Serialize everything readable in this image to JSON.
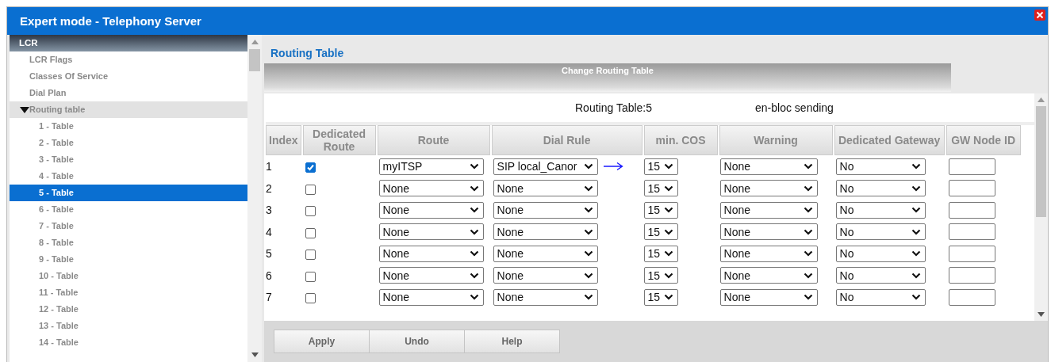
{
  "window": {
    "title": "Expert mode - Telephony Server"
  },
  "sidebar": {
    "header": "LCR",
    "items": [
      {
        "label": "LCR Flags",
        "selected": false
      },
      {
        "label": "Classes Of Service",
        "selected": false
      },
      {
        "label": "Dial Plan",
        "selected": false
      },
      {
        "label": "Routing table",
        "selected": false,
        "expanded": true,
        "children": [
          {
            "label": "1 - Table",
            "selected": false
          },
          {
            "label": "2 - Table",
            "selected": false
          },
          {
            "label": "3 - Table",
            "selected": false
          },
          {
            "label": "4 - Table",
            "selected": false
          },
          {
            "label": "5 - Table",
            "selected": true
          },
          {
            "label": "6 - Table",
            "selected": false
          },
          {
            "label": "7 - Table",
            "selected": false
          },
          {
            "label": "8 - Table",
            "selected": false
          },
          {
            "label": "9 - Table",
            "selected": false
          },
          {
            "label": "10 - Table",
            "selected": false
          },
          {
            "label": "11 - Table",
            "selected": false
          },
          {
            "label": "12 - Table",
            "selected": false
          },
          {
            "label": "13 - Table",
            "selected": false
          },
          {
            "label": "14 - Table",
            "selected": false
          }
        ]
      }
    ]
  },
  "main": {
    "heading": "Routing Table",
    "section_title": "Change Routing Table",
    "table_name": "Routing Table:5",
    "sending_mode": "en-bloc sending",
    "columns": [
      "Index",
      "Dedicated Route",
      "Route",
      "Dial Rule",
      "min. COS",
      "Warning",
      "Dedicated Gateway",
      "GW Node ID"
    ],
    "rows": [
      {
        "index": "1",
        "checked": true,
        "route": "myITSP",
        "dial_rule": "SIP local_Canor",
        "arrow": true,
        "min_cos": "15",
        "warning": "None",
        "gateway": "No"
      },
      {
        "index": "2",
        "checked": false,
        "route": "None",
        "dial_rule": "None",
        "arrow": false,
        "min_cos": "15",
        "warning": "None",
        "gateway": "No"
      },
      {
        "index": "3",
        "checked": false,
        "route": "None",
        "dial_rule": "None",
        "arrow": false,
        "min_cos": "15",
        "warning": "None",
        "gateway": "No"
      },
      {
        "index": "4",
        "checked": false,
        "route": "None",
        "dial_rule": "None",
        "arrow": false,
        "min_cos": "15",
        "warning": "None",
        "gateway": "No"
      },
      {
        "index": "5",
        "checked": false,
        "route": "None",
        "dial_rule": "None",
        "arrow": false,
        "min_cos": "15",
        "warning": "None",
        "gateway": "No"
      },
      {
        "index": "6",
        "checked": false,
        "route": "None",
        "dial_rule": "None",
        "arrow": false,
        "min_cos": "15",
        "warning": "None",
        "gateway": "No"
      },
      {
        "index": "7",
        "checked": false,
        "route": "None",
        "dial_rule": "None",
        "arrow": false,
        "min_cos": "15",
        "warning": "None",
        "gateway": "No"
      }
    ],
    "buttons": [
      "Apply",
      "Undo",
      "Help"
    ]
  }
}
